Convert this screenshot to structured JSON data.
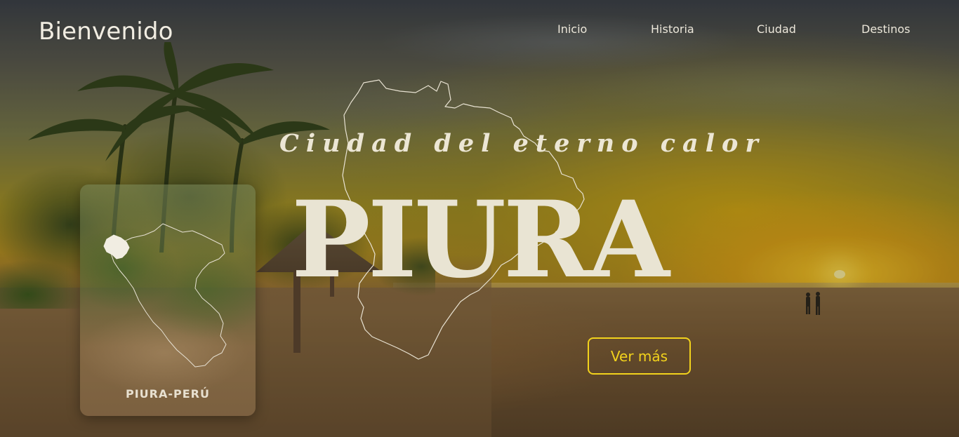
{
  "header": {
    "brand": "Bienvenido",
    "nav": [
      {
        "label": "Inicio"
      },
      {
        "label": "Historia"
      },
      {
        "label": "Ciudad"
      },
      {
        "label": "Destinos"
      }
    ]
  },
  "hero": {
    "tagline": "Ciudad del eterno calor",
    "title": "PIURA",
    "cta_label": "Ver más"
  },
  "card": {
    "caption": "PIURA-PERÚ"
  },
  "colors": {
    "accent": "#f2d21c",
    "text_light": "#e9e4d3"
  }
}
